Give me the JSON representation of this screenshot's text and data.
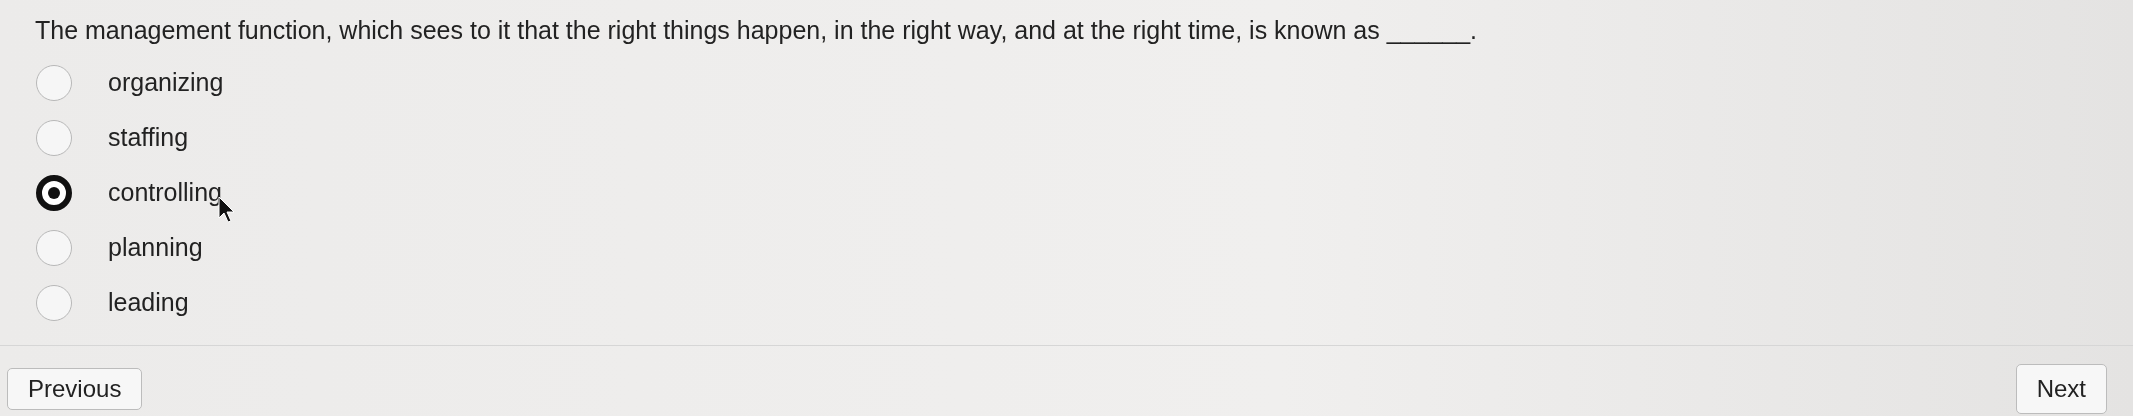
{
  "question": "The management function, which sees to it that the right things happen, in the right way, and at the right time, is known as ______.",
  "options": [
    {
      "label": "organizing",
      "selected": false
    },
    {
      "label": "staffing",
      "selected": false
    },
    {
      "label": "controlling",
      "selected": true
    },
    {
      "label": "planning",
      "selected": false
    },
    {
      "label": "leading",
      "selected": false
    }
  ],
  "buttons": [
    {
      "kind": "previous",
      "label": "Previous"
    },
    {
      "kind": "next",
      "label": "Next"
    }
  ]
}
